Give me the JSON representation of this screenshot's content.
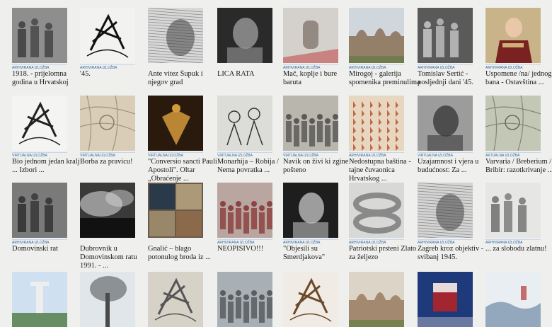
{
  "category_virtual": "VIRTUALNA IZLOŽBA",
  "category_archive": "ARHIVIRANA IZLOŽBA",
  "category_current": "AKTUALNA IZLOŽBA",
  "exhibitions": [
    {
      "title": "1918. - prijelomna godina u Hrvatskoj",
      "category": "ARHIVIRANA IZLOŽBA"
    },
    {
      "title": "'45.",
      "category": "ARHIVIRANA IZLOŽBA"
    },
    {
      "title": "Ante vitez Šupuk i njegov grad",
      "category": ""
    },
    {
      "title": "LICA RATA",
      "category": ""
    },
    {
      "title": "Mač, koplje i bure baruta",
      "category": "ARHIVIRANA IZLOŽBA"
    },
    {
      "title": "Mirogoj - galerija spomenika preminulima",
      "category": "ARHIVIRANA IZLOŽBA"
    },
    {
      "title": "Tomislav Sertić - posljednji dani '45.",
      "category": "ARHIVIRANA IZLOŽBA"
    },
    {
      "title": "Uspomene /na/ jednog bana - Ostavština ...",
      "category": "ARHIVIRANA IZLOŽBA"
    },
    {
      "title": "Bio jednom jedan kralj ... Izbori ...",
      "category": "VIRTUALNA IZLOŽBA"
    },
    {
      "title": "Borba za pravicu!",
      "category": "VIRTUALNA IZLOŽBA"
    },
    {
      "title": "\"Conversio sancti Pauli Apostoli\". Oltar „Obraćenje ...",
      "category": "VIRTUALNA IZLOŽBA"
    },
    {
      "title": "Monarhija – Robija / Nema povratka ...",
      "category": "VIRTUALNA IZLOŽBA"
    },
    {
      "title": "Navik on živi ki zgine pošteno",
      "category": "VIRTUALNA IZLOŽBA"
    },
    {
      "title": "Nedostupna baština - tajne čuvaonica Hrvatskog ...",
      "category": "ARHIVIRANA IZLOŽBA"
    },
    {
      "title": "Uzajamnost i vjera u budućnost: Za ...",
      "category": "VIRTUALNA IZLOŽBA"
    },
    {
      "title": "Varvaria / Breberium / Bribir: razotkrivanje ...",
      "category": "AKTUALNA IZLOŽBA"
    },
    {
      "title": "Domovinski rat",
      "category": "ARHIVIRANA IZLOŽBA"
    },
    {
      "title": "Dubrovnik u Domovinskom ratu 1991. - ...",
      "category": ""
    },
    {
      "title": "Gnalić – blago potonulog broda iz ...",
      "category": ""
    },
    {
      "title": "NEOPISIVO!!!",
      "category": "ARHIVIRANA IZLOŽBA"
    },
    {
      "title": "\"Objesili su Smerdjakova\"",
      "category": "ARHIVIRANA IZLOŽBA"
    },
    {
      "title": "Patriotski prsteni Zlato za željezo",
      "category": "ARHIVIRANA IZLOŽBA"
    },
    {
      "title": "Zagreb kroz objektiv - svibanj 1945.",
      "category": "ARHIVIRANA IZLOŽBA"
    },
    {
      "title": "... za slobodu zlatnu!",
      "category": "ARHIVIRANA IZLOŽBA"
    },
    {
      "title": "",
      "category": ""
    },
    {
      "title": "",
      "category": ""
    },
    {
      "title": "",
      "category": ""
    },
    {
      "title": "",
      "category": ""
    },
    {
      "title": "",
      "category": ""
    },
    {
      "title": "",
      "category": ""
    },
    {
      "title": "",
      "category": ""
    },
    {
      "title": "",
      "category": ""
    }
  ]
}
